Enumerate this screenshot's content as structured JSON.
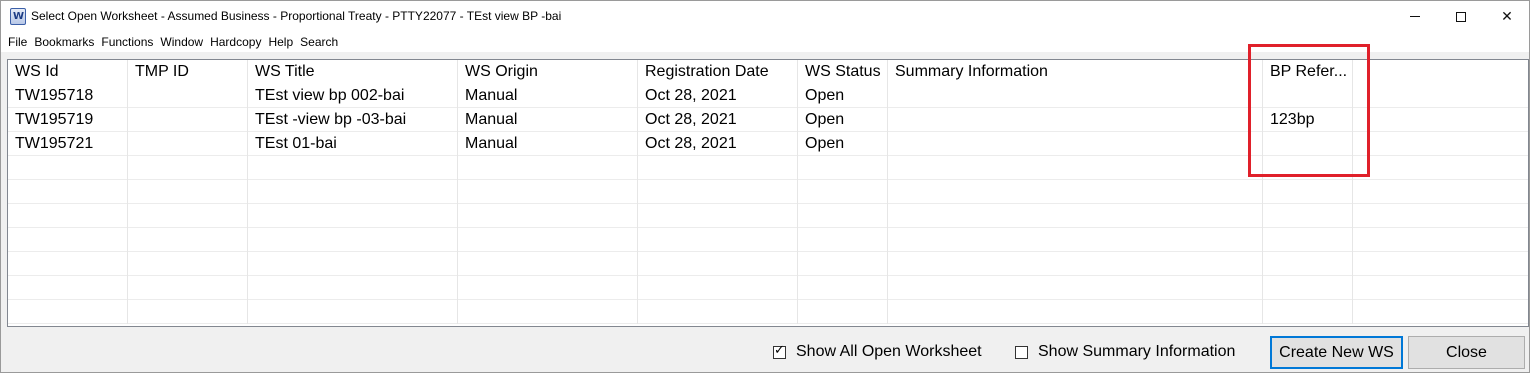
{
  "window": {
    "title": "Select Open Worksheet - Assumed Business - Proportional Treaty - PTTY22077 - TEst view BP -bai",
    "icon": "worksheet-app-icon",
    "controls": {
      "minimize": "minimize-icon",
      "maximize": "maximize-icon",
      "close": "✕"
    }
  },
  "menu": [
    {
      "label": "File"
    },
    {
      "label": "Bookmarks"
    },
    {
      "label": "Functions"
    },
    {
      "label": "Window"
    },
    {
      "label": "Hardcopy"
    },
    {
      "label": "Help"
    },
    {
      "label": "Search"
    }
  ],
  "grid": {
    "columns": [
      {
        "label": "WS Id"
      },
      {
        "label": "TMP ID"
      },
      {
        "label": "WS Title"
      },
      {
        "label": "WS Origin"
      },
      {
        "label": "Registration Date"
      },
      {
        "label": "WS Status"
      },
      {
        "label": "Summary Information"
      },
      {
        "label": "BP Refer..."
      },
      {
        "label": ""
      }
    ],
    "rows": [
      [
        "TW195718",
        "",
        "TEst view bp 002-bai",
        "Manual",
        "Oct 28, 2021",
        "Open",
        "",
        "",
        ""
      ],
      [
        "TW195719",
        "",
        "TEst -view bp -03-bai",
        "Manual",
        "Oct 28, 2021",
        "Open",
        "",
        "123bp",
        ""
      ],
      [
        "TW195721",
        "",
        "TEst 01-bai",
        "Manual",
        "Oct 28, 2021",
        "Open",
        "",
        "",
        ""
      ],
      [
        "",
        "",
        "",
        "",
        "",
        "",
        "",
        "",
        ""
      ],
      [
        "",
        "",
        "",
        "",
        "",
        "",
        "",
        "",
        ""
      ],
      [
        "",
        "",
        "",
        "",
        "",
        "",
        "",
        "",
        ""
      ],
      [
        "",
        "",
        "",
        "",
        "",
        "",
        "",
        "",
        ""
      ],
      [
        "",
        "",
        "",
        "",
        "",
        "",
        "",
        "",
        ""
      ],
      [
        "",
        "",
        "",
        "",
        "",
        "",
        "",
        "",
        ""
      ],
      [
        "",
        "",
        "",
        "",
        "",
        "",
        "",
        "",
        ""
      ]
    ]
  },
  "footer": {
    "show_all_open": {
      "label": "Show All Open Worksheet",
      "checked": true,
      "check_mark": "✓"
    },
    "show_summary": {
      "label": "Show Summary Information",
      "checked": false,
      "check_mark": ""
    },
    "create_button": "Create New WS",
    "close_button": "Close"
  },
  "colors": {
    "highlight": "#e0202a",
    "focus_border": "#0078d7"
  }
}
